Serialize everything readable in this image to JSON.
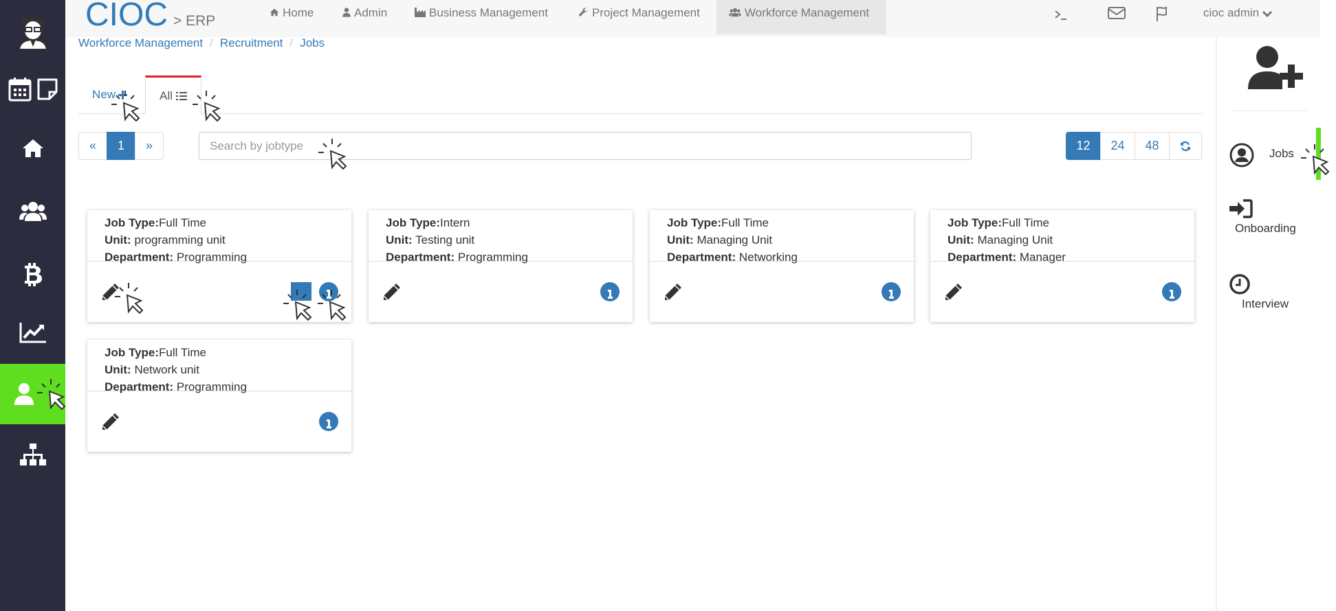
{
  "brand": {
    "name": "CIOC",
    "separator": ">",
    "sub": "ERP"
  },
  "topnav": {
    "items": [
      {
        "label": "Home",
        "icon": "home-icon"
      },
      {
        "label": "Admin",
        "icon": "user-icon"
      },
      {
        "label": "Business Management",
        "icon": "industry-icon"
      },
      {
        "label": "Project Management",
        "icon": "wrench-icon"
      },
      {
        "label": "Workforce Management",
        "icon": "users-icon",
        "active": true
      }
    ],
    "terminal_icon": "terminal-icon",
    "mail_icon": "envelope-icon",
    "flag_icon": "flag-icon",
    "user_menu": "cioc admin"
  },
  "breadcrumb": [
    "Workforce Management",
    "Recruitment",
    "Jobs"
  ],
  "tabs": {
    "new_label": "New",
    "all_label": "All"
  },
  "pagination": {
    "prev": "«",
    "current": "1",
    "next": "»"
  },
  "search": {
    "placeholder": "Search by jobtype",
    "value": ""
  },
  "page_size": {
    "options": [
      "12",
      "24",
      "48"
    ],
    "selected": "12"
  },
  "labels": {
    "job_type": "Job Type:",
    "unit": "Unit:",
    "department": "Department:"
  },
  "jobs": [
    {
      "job_type": "Full Time",
      "unit": "programming unit",
      "department": "Programming"
    },
    {
      "job_type": "Intern",
      "unit": "Testing unit",
      "department": "Programming"
    },
    {
      "job_type": "Full Time",
      "unit": "Managing Unit",
      "department": "Networking"
    },
    {
      "job_type": "Full Time",
      "unit": "Managing Unit",
      "department": "Manager"
    },
    {
      "job_type": "Full Time",
      "unit": "Network unit",
      "department": "Programming"
    }
  ],
  "right_sidebar": {
    "items": [
      {
        "label": "Jobs",
        "icon": "user-circle-icon",
        "active": true
      },
      {
        "label": "Onboarding",
        "icon": "sign-in-icon"
      },
      {
        "label": "Interview",
        "icon": "clock-icon"
      }
    ]
  },
  "colors": {
    "sidebar_bg": "#2c2c3f",
    "accent_green": "#5ede1e",
    "link_blue": "#337ab7",
    "tab_active_red": "#e02020"
  }
}
